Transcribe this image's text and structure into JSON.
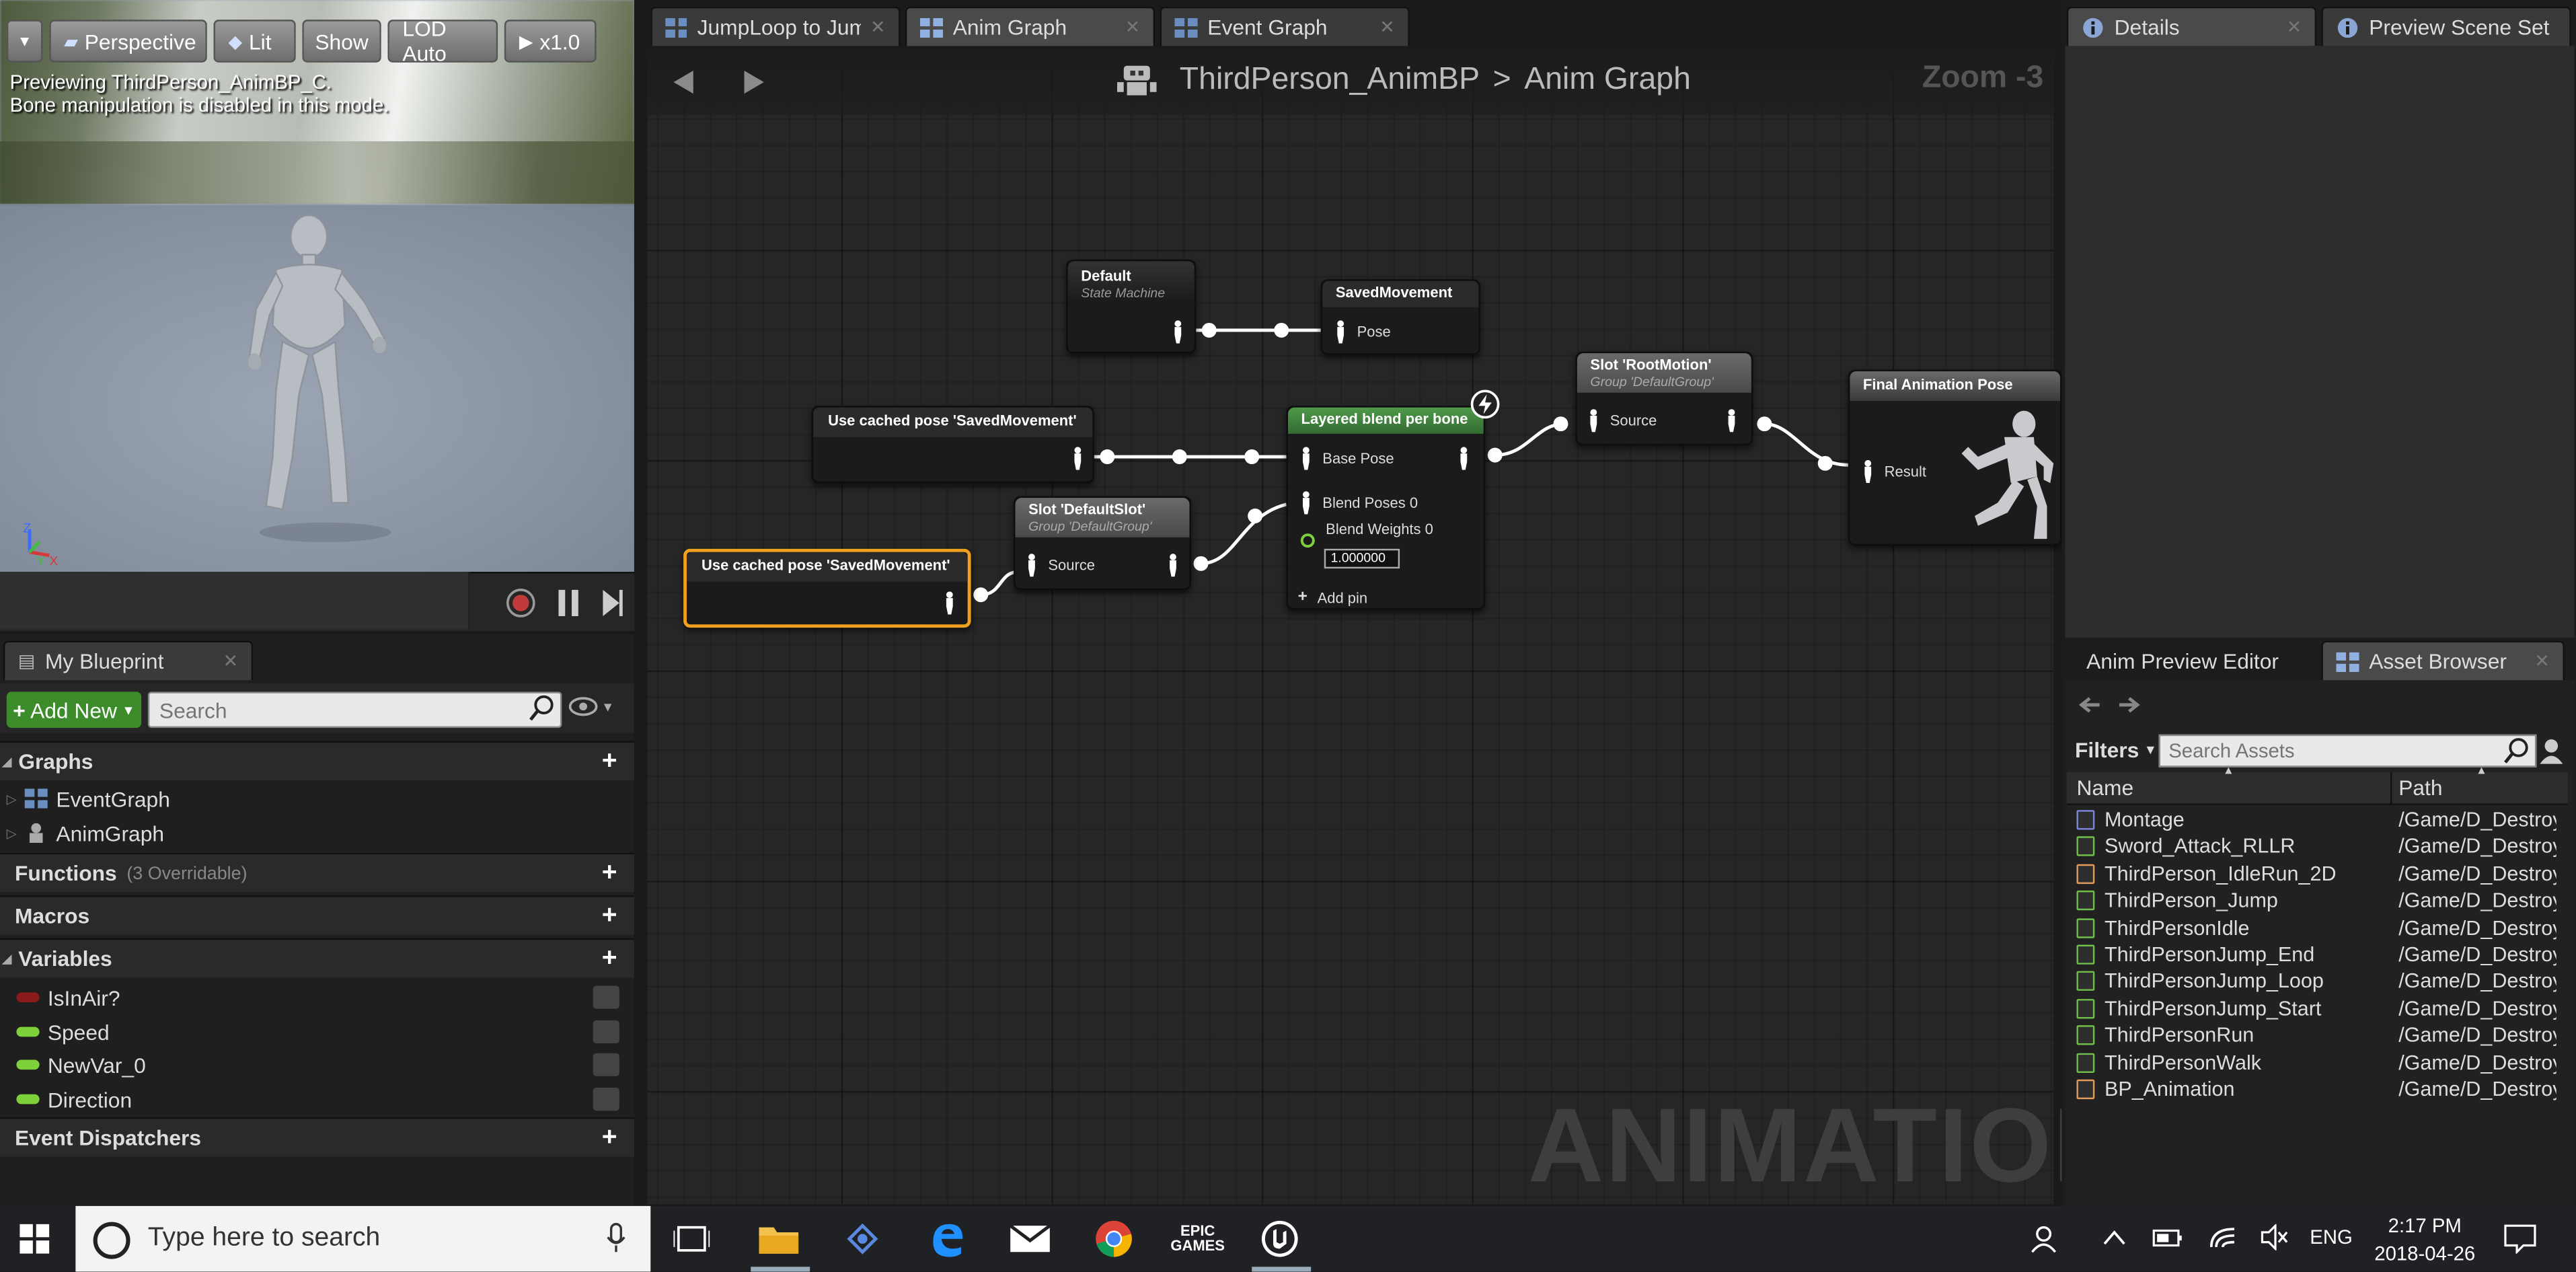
{
  "viewport": {
    "toolbar": [
      "Perspective",
      "Lit",
      "Show",
      "LOD Auto",
      "x1.0"
    ],
    "info_line1": "Previewing ThirdPerson_AnimBP_C.",
    "info_line2": "Bone manipulation is disabled in this mode."
  },
  "tabs": [
    {
      "label": "JumpLoop to Jum"
    },
    {
      "label": "Anim Graph"
    },
    {
      "label": "Event Graph"
    }
  ],
  "graph": {
    "breadcrumb_root": "ThirdPerson_AnimBP",
    "breadcrumb_sep": ">",
    "breadcrumb_leaf": "Anim Graph",
    "zoom": "Zoom -3",
    "watermark": "ANIMATION"
  },
  "nodes": {
    "default_title": "Default",
    "default_sub": "State Machine",
    "saved_title": "SavedMovement",
    "saved_pin": "Pose",
    "cached1_title": "Use cached pose 'SavedMovement'",
    "cached2_title": "Use cached pose 'SavedMovement'",
    "slot_default_title": "Slot 'DefaultSlot'",
    "slot_default_sub": "Group 'DefaultGroup'",
    "slot_default_pin": "Source",
    "layered_title": "Layered blend per bone",
    "layered_base": "Base Pose",
    "layered_blend": "Blend Poses 0",
    "layered_weights": "Blend Weights 0",
    "layered_weight_value": "1.000000",
    "layered_addpin": "Add pin",
    "slot_root_title": "Slot 'RootMotion'",
    "slot_root_sub": "Group 'DefaultGroup'",
    "slot_root_pin": "Source",
    "final_title": "Final Animation Pose",
    "final_pin": "Result"
  },
  "my_blueprint": {
    "tab": "My Blueprint",
    "add_new": "Add New",
    "search_placeholder": "Search",
    "graphs": "Graphs",
    "graph_items": [
      "EventGraph",
      "AnimGraph"
    ],
    "functions": "Functions",
    "functions_sub": "(3 Overridable)",
    "macros": "Macros",
    "variables": "Variables",
    "variable_items": [
      {
        "name": "IsInAir?",
        "color": "#8b1a1a"
      },
      {
        "name": "Speed",
        "color": "#7fd13b"
      },
      {
        "name": "NewVar_0",
        "color": "#7fd13b"
      },
      {
        "name": "Direction",
        "color": "#7fd13b"
      }
    ],
    "dispatchers": "Event Dispatchers"
  },
  "right_panel": {
    "details_tab": "Details",
    "preview_tab": "Preview Scene Set",
    "anim_preview_tab": "Anim Preview Editor",
    "asset_browser_tab": "Asset Browser",
    "filters": "Filters",
    "search_placeholder": "Search Assets",
    "col_name": "Name",
    "col_path": "Path",
    "assets": [
      {
        "name": "Montage",
        "path": "/Game/D_Destroy",
        "kind": "montage"
      },
      {
        "name": "Sword_Attack_RLLR",
        "path": "/Game/D_Destroy",
        "kind": "sequence"
      },
      {
        "name": "ThirdPerson_IdleRun_2D",
        "path": "/Game/D_Destroy",
        "kind": "blendspace"
      },
      {
        "name": "ThirdPerson_Jump",
        "path": "/Game/D_Destroy",
        "kind": "sequence"
      },
      {
        "name": "ThirdPersonIdle",
        "path": "/Game/D_Destroy",
        "kind": "sequence"
      },
      {
        "name": "ThirdPersonJump_End",
        "path": "/Game/D_Destroy",
        "kind": "sequence"
      },
      {
        "name": "ThirdPersonJump_Loop",
        "path": "/Game/D_Destroy",
        "kind": "sequence"
      },
      {
        "name": "ThirdPersonJump_Start",
        "path": "/Game/D_Destroy",
        "kind": "sequence"
      },
      {
        "name": "ThirdPersonRun",
        "path": "/Game/D_Destroy",
        "kind": "sequence"
      },
      {
        "name": "ThirdPersonWalk",
        "path": "/Game/D_Destroy",
        "kind": "sequence"
      },
      {
        "name": "BP_Animation",
        "path": "/Game/D_Destroy",
        "kind": "blendspace"
      }
    ]
  },
  "taskbar": {
    "search_placeholder": "Type here to search",
    "lang": "ENG",
    "time": "2:17 PM",
    "date": "2018-04-26"
  },
  "colors": {
    "accent_green": "#3d8c2b",
    "layered_header": "#3d7a3a",
    "selection_orange": "#f0a020",
    "blueprint_icon": "#5a8adf"
  }
}
